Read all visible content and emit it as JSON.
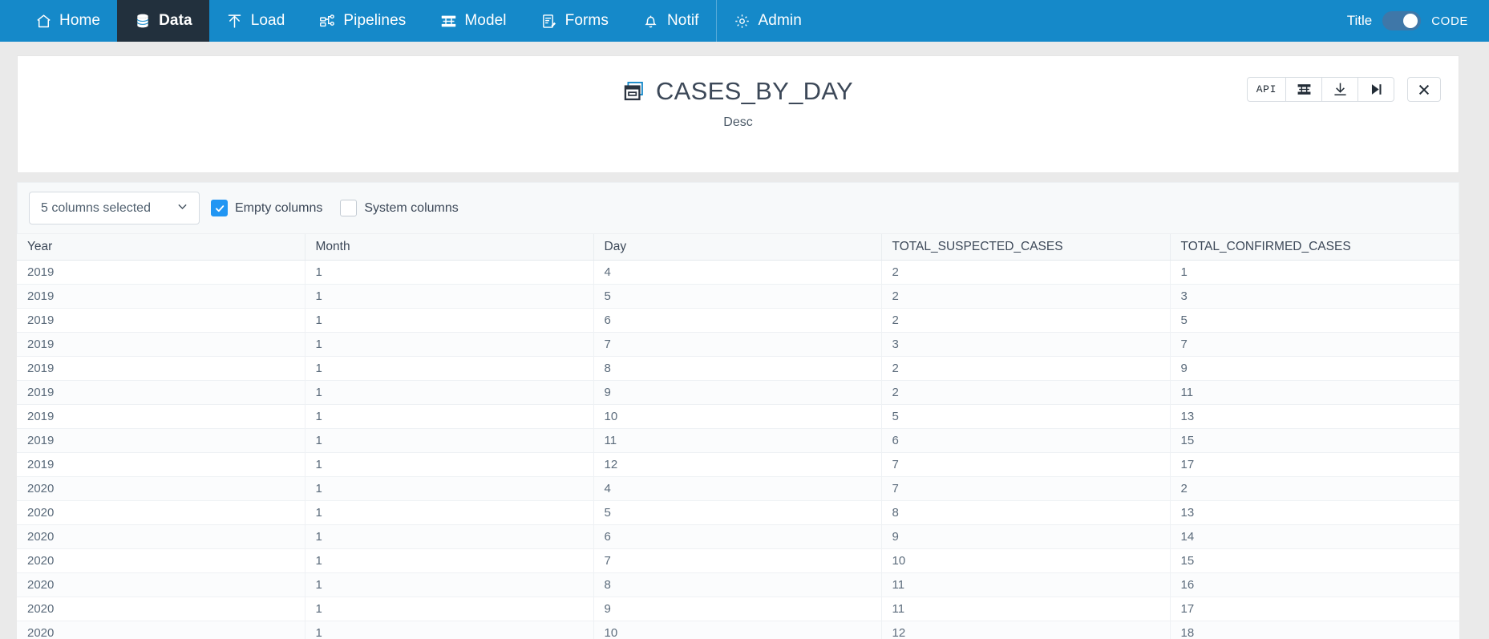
{
  "navbar": {
    "items": [
      {
        "label": "Home",
        "icon": "home-icon",
        "active": false
      },
      {
        "label": "Data",
        "icon": "database-icon",
        "active": true
      },
      {
        "label": "Load",
        "icon": "upload-icon",
        "active": false
      },
      {
        "label": "Pipelines",
        "icon": "pipeline-icon",
        "active": false
      },
      {
        "label": "Model",
        "icon": "model-icon",
        "active": false
      },
      {
        "label": "Forms",
        "icon": "forms-icon",
        "active": false
      },
      {
        "label": "Notif",
        "icon": "bell-icon",
        "active": false
      },
      {
        "label": "Admin",
        "icon": "gear-icon",
        "active": false
      }
    ],
    "right": {
      "title_label": "Title",
      "code_label": "CODE",
      "toggle_state": "on"
    },
    "background_color": "#1589c9",
    "active_color": "#22303d"
  },
  "header": {
    "icon": "table-window-icon",
    "title": "CASES_BY_DAY",
    "description": "Desc",
    "actions": [
      {
        "label": "API",
        "icon": "api-text",
        "name": "api-button"
      },
      {
        "label": "",
        "icon": "model-icon",
        "name": "model-button"
      },
      {
        "label": "",
        "icon": "download-icon",
        "name": "download-button"
      },
      {
        "label": "",
        "icon": "skip-end-icon",
        "name": "skip-end-button"
      }
    ],
    "close_label": "",
    "close_icon": "close-icon"
  },
  "filters": {
    "column_select_value": "5 columns selected",
    "column_select_icon": "chevron-down-icon",
    "checkboxes": [
      {
        "label": "Empty columns",
        "checked": true,
        "name": "empty-columns-checkbox"
      },
      {
        "label": "System columns",
        "checked": false,
        "name": "system-columns-checkbox"
      }
    ]
  },
  "table": {
    "columns": [
      "Year",
      "Month",
      "Day",
      "TOTAL_SUSPECTED_CASES",
      "TOTAL_CONFIRMED_CASES"
    ],
    "rows": [
      [
        "2019",
        "1",
        "4",
        "2",
        "1"
      ],
      [
        "2019",
        "1",
        "5",
        "2",
        "3"
      ],
      [
        "2019",
        "1",
        "6",
        "2",
        "5"
      ],
      [
        "2019",
        "1",
        "7",
        "3",
        "7"
      ],
      [
        "2019",
        "1",
        "8",
        "2",
        "9"
      ],
      [
        "2019",
        "1",
        "9",
        "2",
        "11"
      ],
      [
        "2019",
        "1",
        "10",
        "5",
        "13"
      ],
      [
        "2019",
        "1",
        "11",
        "6",
        "15"
      ],
      [
        "2019",
        "1",
        "12",
        "7",
        "17"
      ],
      [
        "2020",
        "1",
        "4",
        "7",
        "2"
      ],
      [
        "2020",
        "1",
        "5",
        "8",
        "13"
      ],
      [
        "2020",
        "1",
        "6",
        "9",
        "14"
      ],
      [
        "2020",
        "1",
        "7",
        "10",
        "15"
      ],
      [
        "2020",
        "1",
        "8",
        "11",
        "16"
      ],
      [
        "2020",
        "1",
        "9",
        "11",
        "17"
      ],
      [
        "2020",
        "1",
        "10",
        "12",
        "18"
      ]
    ]
  },
  "colors": {
    "brand": "#1589c9",
    "accent": "#2196f3",
    "page_bg": "#eaeaea",
    "nav_active": "#22303d"
  }
}
